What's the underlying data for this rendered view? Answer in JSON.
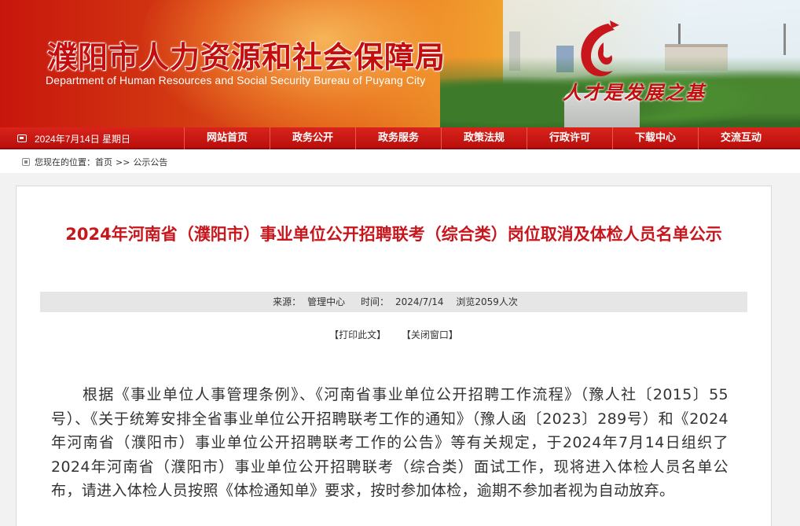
{
  "header": {
    "title_cn": "濮阳市人力资源和社会保障局",
    "title_en": "Department of Human  Resources and Social Security Bureau of Puyang City",
    "slogan": "人才是发展之基"
  },
  "navbar": {
    "date": "2024年7月14日 星期日",
    "items": [
      "网站首页",
      "政务公开",
      "政务服务",
      "政策法规",
      "行政许可",
      "下载中心",
      "交流互动"
    ]
  },
  "breadcrumb": {
    "prefix": "您现在的位置：",
    "home": "首页",
    "separator": ">>",
    "current": "公示公告"
  },
  "article": {
    "title": "2024年河南省（濮阳市）事业单位公开招聘联考（综合类）岗位取消及体检人员名单公示",
    "meta": {
      "source_label": "来源：",
      "source": "管理中心",
      "time_label": "时间：",
      "time": "2024/7/14",
      "views_text": "浏览2059人次"
    },
    "tools": {
      "print": "【打印此文】",
      "close": "【关闭窗口】"
    },
    "body": "根据《事业单位人事管理条例》、《河南省事业单位公开招聘工作流程》（豫人社〔2015〕55号）、《关于统筹安排全省事业单位公开招聘联考工作的通知》（豫人函〔2023〕289号）和《2024年河南省（濮阳市）事业单位公开招聘联考工作的公告》等有关规定，于2024年7月14日组织了2024年河南省（濮阳市）事业单位公开招聘联考（综合类）面试工作，现将进入体检人员名单公布，请进入体检人员按照《体检通知单》要求，按时参加体检，逾期不参加者视为自动放弃。"
  },
  "colors": {
    "brand_red": "#c8161d",
    "nav_red": "#c4160f",
    "meta_bg": "#e6e6e6"
  }
}
